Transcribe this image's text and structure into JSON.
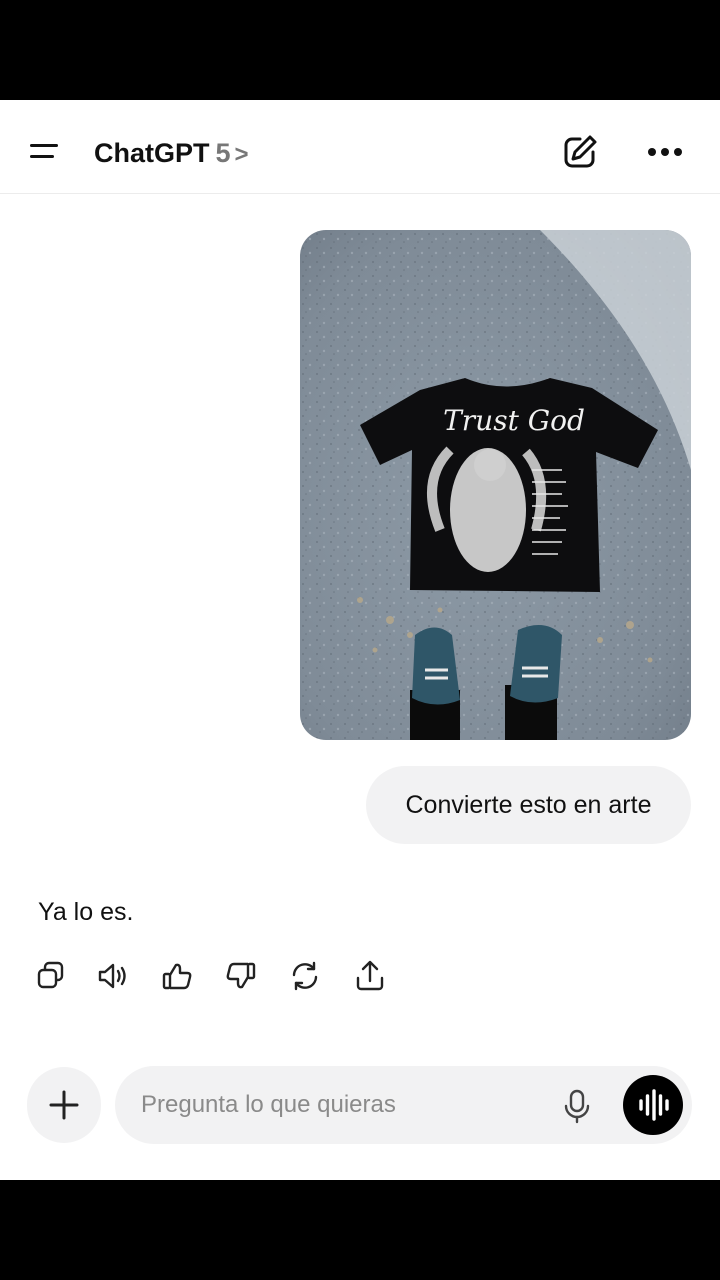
{
  "header": {
    "title": "ChatGPT",
    "model_version": "5",
    "chevron": ">"
  },
  "conversation": {
    "user_message": "Convierte esto en arte",
    "assistant_message": "Ya lo es.",
    "image_shirt_text": "Trust God"
  },
  "response_actions": [
    {
      "icon": "copy-icon"
    },
    {
      "icon": "speaker-icon"
    },
    {
      "icon": "thumbs-up-icon"
    },
    {
      "icon": "thumbs-down-icon"
    },
    {
      "icon": "regenerate-icon"
    },
    {
      "icon": "share-icon"
    }
  ],
  "composer": {
    "placeholder": "Pregunta lo que quieras"
  },
  "colors": {
    "background": "#ffffff",
    "bubble": "#f2f2f3",
    "text": "#111111",
    "muted": "#777777",
    "voice_button": "#000000"
  }
}
